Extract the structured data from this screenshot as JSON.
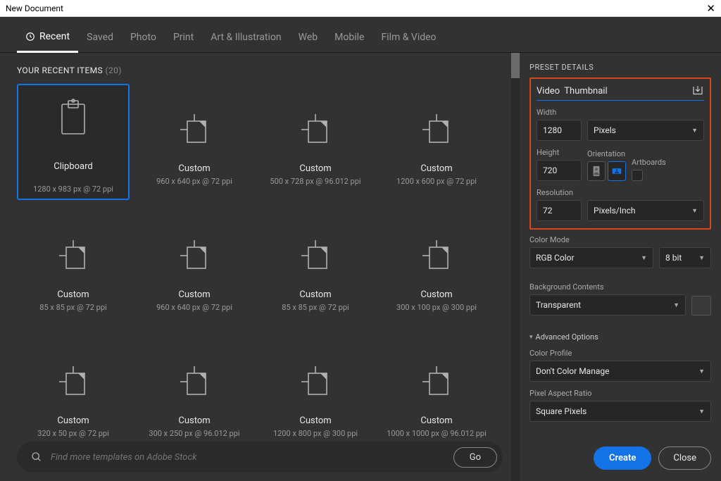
{
  "window": {
    "title": "New Document"
  },
  "tabs": [
    "Recent",
    "Saved",
    "Photo",
    "Print",
    "Art & Illustration",
    "Web",
    "Mobile",
    "Film & Video"
  ],
  "active_tab": 0,
  "recent": {
    "header": "YOUR RECENT ITEMS",
    "count": "(20)",
    "items": [
      {
        "name": "Clipboard",
        "desc": "1280 x 983 px @ 72 ppi",
        "icon": "clipboard",
        "selected": true
      },
      {
        "name": "Custom",
        "desc": "960 x 640 px @ 72 ppi",
        "icon": "doc"
      },
      {
        "name": "Custom",
        "desc": "500 x 728 px @ 96.012 ppi",
        "icon": "doc"
      },
      {
        "name": "Custom",
        "desc": "1200 x 600 px @ 72 ppi",
        "icon": "doc"
      },
      {
        "name": "Custom",
        "desc": "85 x 85 px @ 72 ppi",
        "icon": "doc"
      },
      {
        "name": "Custom",
        "desc": "960 x 640 px @ 72 ppi",
        "icon": "doc"
      },
      {
        "name": "Custom",
        "desc": "85 x 85 px @ 72 ppi",
        "icon": "doc"
      },
      {
        "name": "Custom",
        "desc": "300 x 100 px @ 300 ppi",
        "icon": "doc"
      },
      {
        "name": "Custom",
        "desc": "320 x 50 px @ 72 ppi",
        "icon": "doc"
      },
      {
        "name": "Custom",
        "desc": "300 x 250 px @ 96.012 ppi",
        "icon": "doc"
      },
      {
        "name": "Custom",
        "desc": "1200 x 800 px @ 300 ppi",
        "icon": "doc"
      },
      {
        "name": "Custom",
        "desc": "1000 x 1000 px @ 96.012 ppi",
        "icon": "doc"
      }
    ]
  },
  "search": {
    "placeholder": "Find more templates on Adobe Stock",
    "go": "Go"
  },
  "preset": {
    "header": "PRESET DETAILS",
    "name": "Video  Thumbnail",
    "width_label": "Width",
    "width": "1280",
    "width_unit": "Pixels",
    "height_label": "Height",
    "height": "720",
    "orientation_label": "Orientation",
    "artboards_label": "Artboards",
    "resolution_label": "Resolution",
    "resolution": "72",
    "resolution_unit": "Pixels/Inch",
    "color_mode_label": "Color Mode",
    "color_mode": "RGB Color",
    "depth": "8 bit",
    "bg_label": "Background Contents",
    "bg": "Transparent",
    "advanced": "Advanced Options",
    "profile_label": "Color Profile",
    "profile": "Don't Color Manage",
    "par_label": "Pixel Aspect Ratio",
    "par": "Square Pixels"
  },
  "buttons": {
    "create": "Create",
    "close": "Close"
  }
}
